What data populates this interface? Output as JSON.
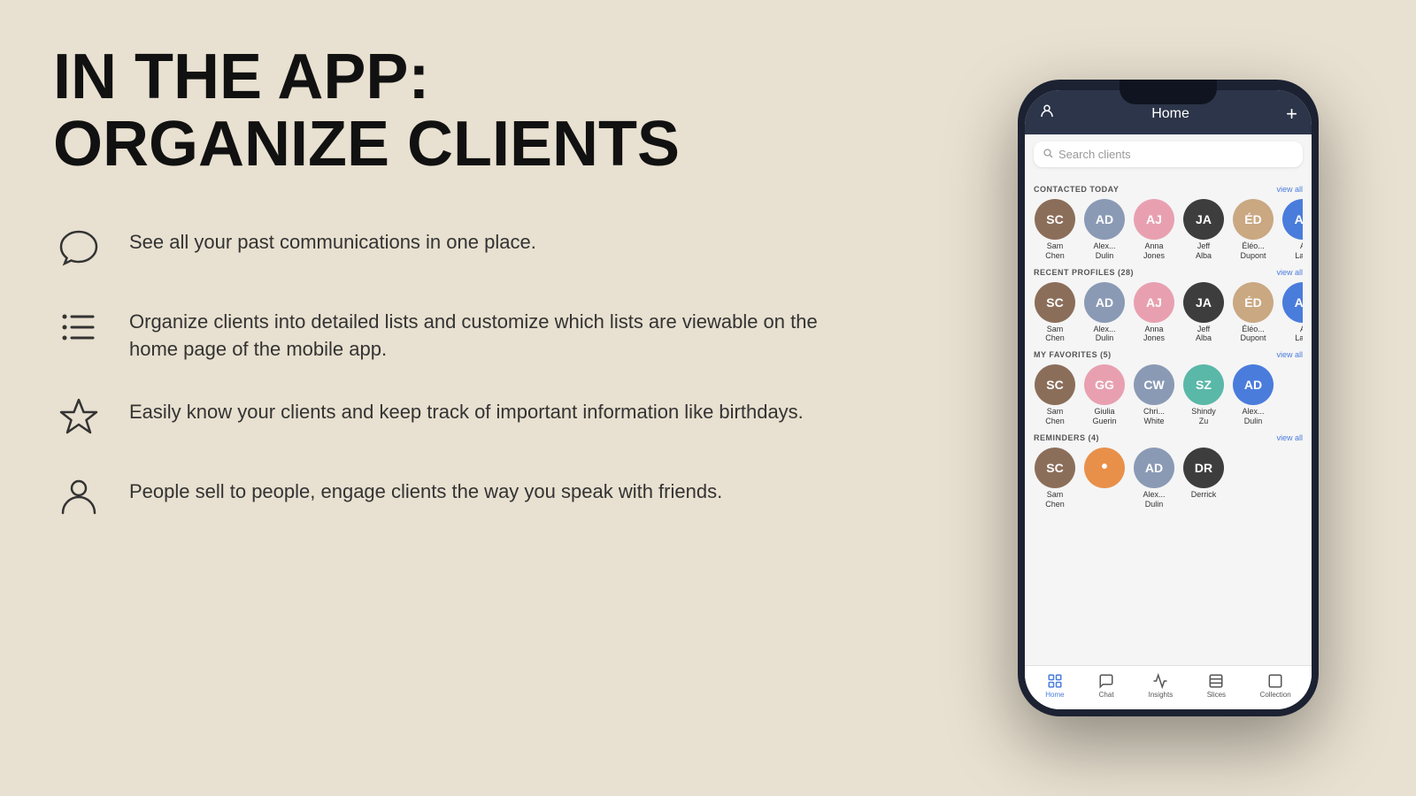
{
  "page": {
    "background_color": "#e8e0d0"
  },
  "left": {
    "title_line1": "IN THE APP:",
    "title_line2": "ORGANIZE CLIENTS",
    "features": [
      {
        "id": "chat",
        "icon": "chat",
        "text": "See all your past communications in one place."
      },
      {
        "id": "list",
        "icon": "list",
        "text": "Organize clients into detailed lists and customize which lists are viewable on the home page of the mobile app."
      },
      {
        "id": "star",
        "icon": "star",
        "text": "Easily know your clients and keep track of important information like birthdays."
      },
      {
        "id": "person",
        "icon": "person",
        "text": "People sell to people, engage clients the way you speak with friends."
      }
    ]
  },
  "app": {
    "header": {
      "title": "Home",
      "plus_label": "+",
      "person_icon": "person"
    },
    "search": {
      "placeholder": "Search clients"
    },
    "sections": [
      {
        "id": "contacted-today",
        "title": "CONTACTED TODAY",
        "view_all": "view all",
        "count": null,
        "avatars": [
          {
            "name": "Sam\nChen",
            "initials": "SC",
            "color": "av-brown"
          },
          {
            "name": "Alex...\nDulin",
            "initials": "AD",
            "color": "av-gray"
          },
          {
            "name": "Anna\nJones",
            "initials": "AJ",
            "color": "av-pink"
          },
          {
            "name": "Jeff\nAlba",
            "initials": "JA",
            "color": "av-dark"
          },
          {
            "name": "Éléo...\nDupont",
            "initials": "ÉD",
            "color": "av-tan"
          },
          {
            "name": "A\nLa...",
            "initials": "AL",
            "color": "av-blue"
          }
        ]
      },
      {
        "id": "recent-profiles",
        "title": "RECENT PROFILES (28)",
        "view_all": "view all",
        "count": 28,
        "avatars": [
          {
            "name": "Sam\nChen",
            "initials": "SC",
            "color": "av-brown"
          },
          {
            "name": "Alex...\nDulin",
            "initials": "AD",
            "color": "av-gray"
          },
          {
            "name": "Anna\nJones",
            "initials": "AJ",
            "color": "av-pink"
          },
          {
            "name": "Jeff\nAlba",
            "initials": "JA",
            "color": "av-dark"
          },
          {
            "name": "Éléo...\nDupont",
            "initials": "ÉD",
            "color": "av-tan"
          },
          {
            "name": "A\nLa...",
            "initials": "AL",
            "color": "av-blue"
          }
        ]
      },
      {
        "id": "my-favorites",
        "title": "MY FAVORITES (5)",
        "view_all": "view all",
        "count": 5,
        "avatars": [
          {
            "name": "Sam\nChen",
            "initials": "SC",
            "color": "av-brown"
          },
          {
            "name": "Giulia\nGuerin",
            "initials": "GG",
            "color": "av-pink"
          },
          {
            "name": "Chri...\nWhite",
            "initials": "CW",
            "color": "av-gray"
          },
          {
            "name": "Shindy\nZu",
            "initials": "SZ",
            "color": "av-teal"
          },
          {
            "name": "Alex...\nDulin",
            "initials": "AD",
            "color": "av-blue"
          }
        ]
      },
      {
        "id": "reminders",
        "title": "REMINDERS (4)",
        "view_all": "view all",
        "count": 4,
        "avatars": [
          {
            "name": "Sam\nChen",
            "initials": "SC",
            "color": "av-brown"
          },
          {
            "name": "",
            "initials": "•",
            "color": "av-orange"
          },
          {
            "name": "Alex...\nDulin",
            "initials": "AD",
            "color": "av-gray"
          },
          {
            "name": "Derrick",
            "initials": "DR",
            "color": "av-dark"
          }
        ]
      }
    ],
    "bottom_nav": [
      {
        "id": "home",
        "label": "Home",
        "icon": "⊞",
        "active": true
      },
      {
        "id": "chat",
        "label": "Chat",
        "icon": "◯",
        "active": false
      },
      {
        "id": "insights",
        "label": "Insights",
        "icon": "⬚",
        "active": false
      },
      {
        "id": "slices",
        "label": "Slices",
        "icon": "⊟",
        "active": false
      },
      {
        "id": "collection",
        "label": "Collection",
        "icon": "☐",
        "active": false
      }
    ]
  }
}
